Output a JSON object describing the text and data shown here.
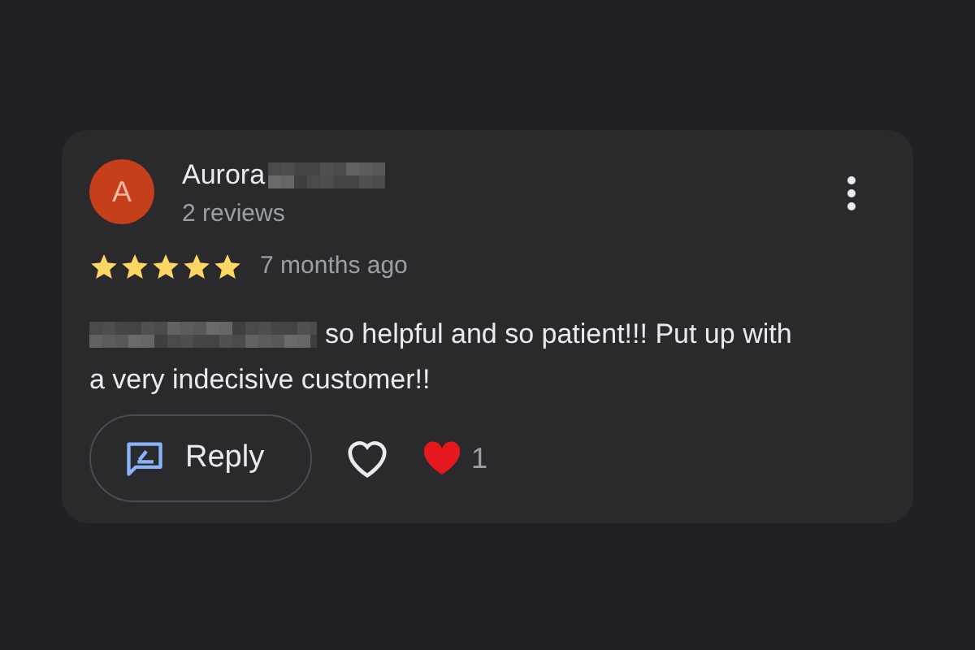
{
  "review": {
    "avatar_letter": "A",
    "author": "Aurora",
    "review_count": "2 reviews",
    "stars": 5,
    "time": "7 months ago",
    "text_lines": [
      "so helpful and so patient!!! Put up with",
      "a very indecisive customer!!"
    ],
    "reply_label": "Reply",
    "liked": false,
    "reaction_count": "1"
  }
}
